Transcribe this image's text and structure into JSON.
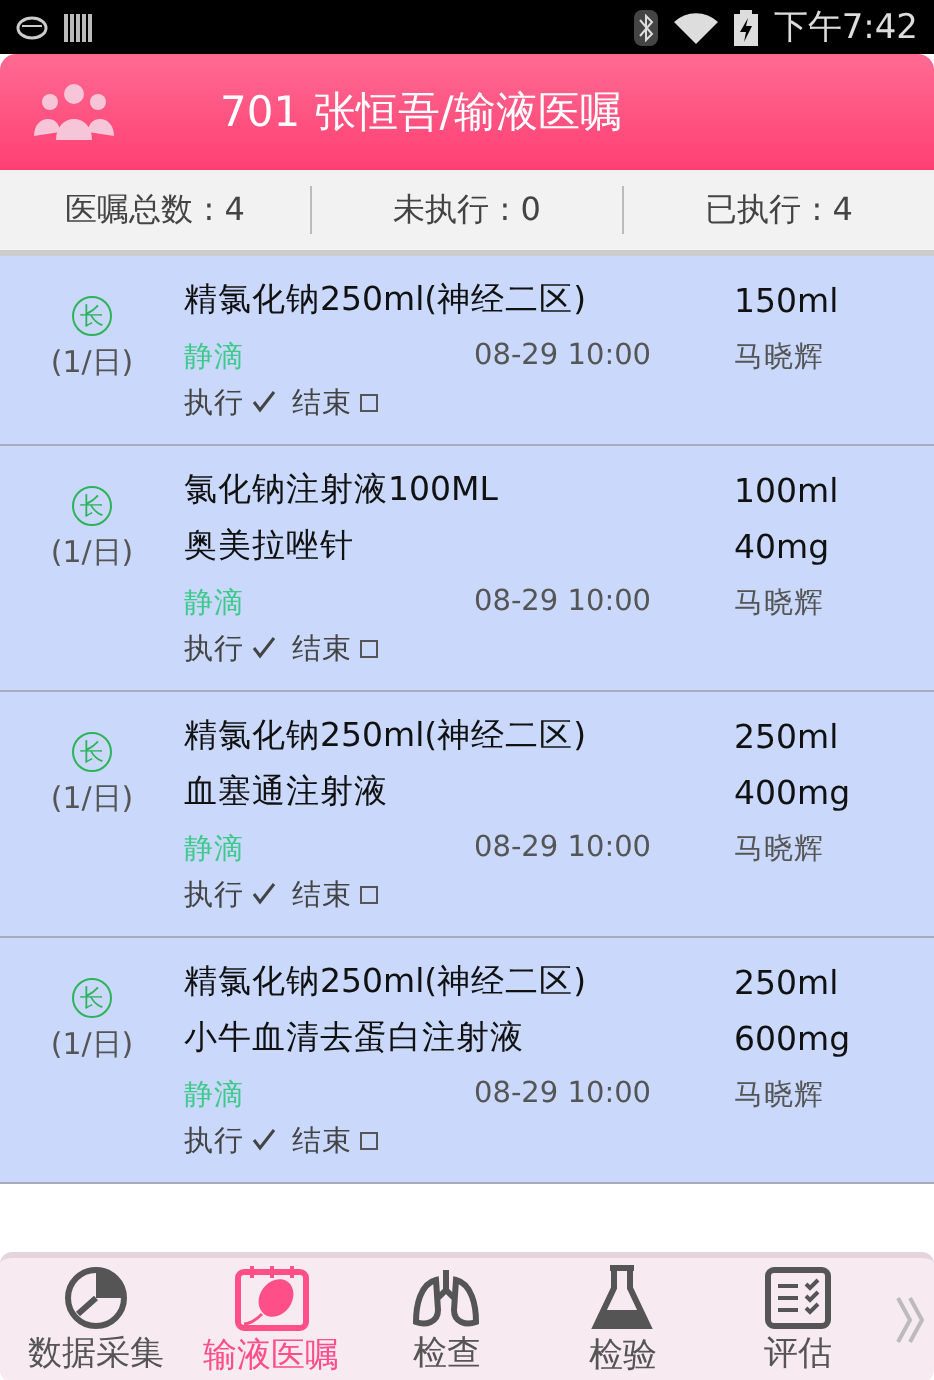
{
  "status_bar": {
    "time": "下午7:42"
  },
  "header": {
    "title": "701 张恒吾/输液医嘱"
  },
  "summary": [
    {
      "label": "医嘱总数 : 4"
    },
    {
      "label": "未执行 : 0"
    },
    {
      "label": "已执行 : 4"
    }
  ],
  "orders": [
    {
      "badge": "长",
      "frequency": "(1/日)",
      "drugs": [
        {
          "name": "精氯化钠250ml(神经二区)",
          "dose": "150ml"
        }
      ],
      "route": "静滴",
      "time": "08-29 10:00",
      "doctor": "马晓辉",
      "executed_label": "执行",
      "executed": true,
      "ended_label": "结束",
      "ended": false
    },
    {
      "badge": "长",
      "frequency": "(1/日)",
      "drugs": [
        {
          "name": "氯化钠注射液100ML",
          "dose": "100ml"
        },
        {
          "name": "奥美拉唑针",
          "dose": "40mg"
        }
      ],
      "route": "静滴",
      "time": "08-29 10:00",
      "doctor": "马晓辉",
      "executed_label": "执行",
      "executed": true,
      "ended_label": "结束",
      "ended": false
    },
    {
      "badge": "长",
      "frequency": "(1/日)",
      "drugs": [
        {
          "name": "精氯化钠250ml(神经二区)",
          "dose": "250ml"
        },
        {
          "name": "血塞通注射液",
          "dose": "400mg"
        }
      ],
      "route": "静滴",
      "time": "08-29 10:00",
      "doctor": "马晓辉",
      "executed_label": "执行",
      "executed": true,
      "ended_label": "结束",
      "ended": false
    },
    {
      "badge": "长",
      "frequency": "(1/日)",
      "drugs": [
        {
          "name": "精氯化钠250ml(神经二区)",
          "dose": "250ml"
        },
        {
          "name": "小牛血清去蛋白注射液",
          "dose": "600mg"
        }
      ],
      "route": "静滴",
      "time": "08-29 10:00",
      "doctor": "马晓辉",
      "executed_label": "执行",
      "executed": true,
      "ended_label": "结束",
      "ended": false
    }
  ],
  "nav": [
    {
      "kind": "gauge",
      "label": "数据采集",
      "selected": false
    },
    {
      "kind": "infusion",
      "label": "输液医嘱",
      "selected": true
    },
    {
      "kind": "lungs",
      "label": "检查",
      "selected": false
    },
    {
      "kind": "flask",
      "label": "检验",
      "selected": false
    },
    {
      "kind": "checklist",
      "label": "评估",
      "selected": false
    }
  ]
}
